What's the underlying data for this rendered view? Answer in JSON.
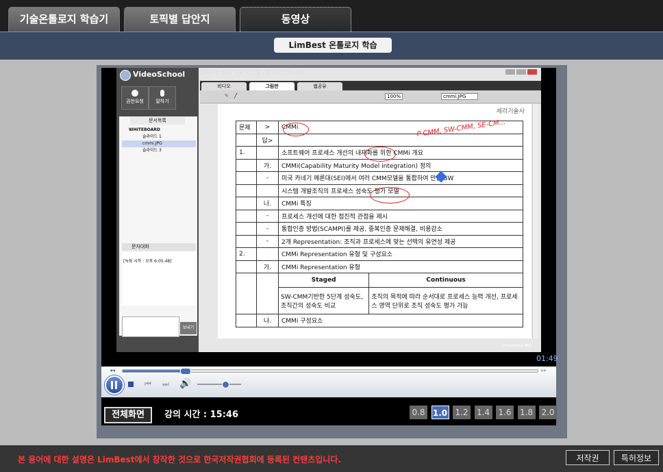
{
  "tabs": [
    {
      "label": "기술온톨로지 학습기",
      "active": false
    },
    {
      "label": "토픽별 답안지",
      "active": false
    },
    {
      "label": "동영상",
      "active": true
    }
  ],
  "title": "LimBest 온톨로지 학습",
  "videoschool": {
    "brand": "VideoSchool",
    "window_title": "임베스트 화상 교육 시스템 (경과시간 00:49)",
    "tabs": [
      "비디오",
      "그림판",
      "웹공유"
    ],
    "left_buttons": [
      "권한요청",
      "말하기"
    ],
    "panel_tab": "문서목록",
    "tree_root": "WHITEBOARD",
    "tree_items": [
      "슬라이드 1",
      "cmmi.JPG",
      "슬라이드 3"
    ],
    "chat_title": "문자대화",
    "chat_text": "[녹화 시작 : 오후 6:05:48]",
    "send_label": "보내기",
    "zoom": "100%",
    "file_select": "cmmi.JPG",
    "powered": "Powered by 4NB"
  },
  "document": {
    "header": "세리기술사",
    "rows": [
      [
        "문제",
        ">",
        "CMMi"
      ],
      [
        "",
        "답>",
        ""
      ],
      [
        "1.",
        "",
        "소프트웨어 프로세스 개선의 내재화를 위한 CMMi 개요"
      ],
      [
        "",
        "가.",
        "CMMi(Capability Maturity Model integration) 정의"
      ],
      [
        "",
        "-",
        "미국 카네기 메론대(SEI)에서 여러 CMM모델을 통합하여 만든 SW"
      ],
      [
        "",
        "",
        "시스템 개발조직의 프로세스 성숙도 평가 모델"
      ],
      [
        "",
        "나.",
        "CMMi 특징"
      ],
      [
        "",
        "-",
        "프로세스 개선에 대한 점진적 관점을 제시"
      ],
      [
        "",
        "-",
        "통합인증 방법(SCAMPI)를 제공, 중복인증 문제해결, 비용감소"
      ],
      [
        "",
        "-",
        "2개 Representation: 조직과 프로세스에 맞는 선택의 유연성 제공"
      ],
      [
        "2.",
        "",
        "CMMi Representation 유형 및 구성요소"
      ],
      [
        "",
        "가.",
        "CMMi Representation 유형"
      ]
    ],
    "sub_headers": [
      "Staged",
      "Continuous"
    ],
    "sub_cells": [
      "SW-CMM기반한 5단계 성숙도, 조직간의 성숙도 비교",
      "조직의 목적에 따라 순서대로 프로세스 능력 개선, 프로세스 영역 단위로 조직 성숙도 평가 가능"
    ],
    "last_row": [
      "",
      "나.",
      "CMMi 구성요소"
    ],
    "handwriting": "P-CMM, SW-CMM, SE-CM..."
  },
  "player": {
    "elapsed": "01:49",
    "fullscreen_label": "전체화면",
    "lecture_time_label": "강의 시간 : 15:46",
    "speeds": [
      "0.8",
      "1.0",
      "1.2",
      "1.4",
      "1.6",
      "1.8",
      "2.0"
    ],
    "active_speed": "1.0",
    "progress": 0.15,
    "volume": 0.62
  },
  "footer": {
    "notice": "본 용어에 대한 설명은 LimBest에서 창작한 것으로 한국저작권협회에 등록된 컨텐츠입니다.",
    "copyright_btn": "저작권",
    "patent_btn": "특허정보"
  },
  "colors": {
    "accent": "#4a6db0",
    "notice": "#ff3b3b",
    "titlebar": "#3b4a63"
  }
}
